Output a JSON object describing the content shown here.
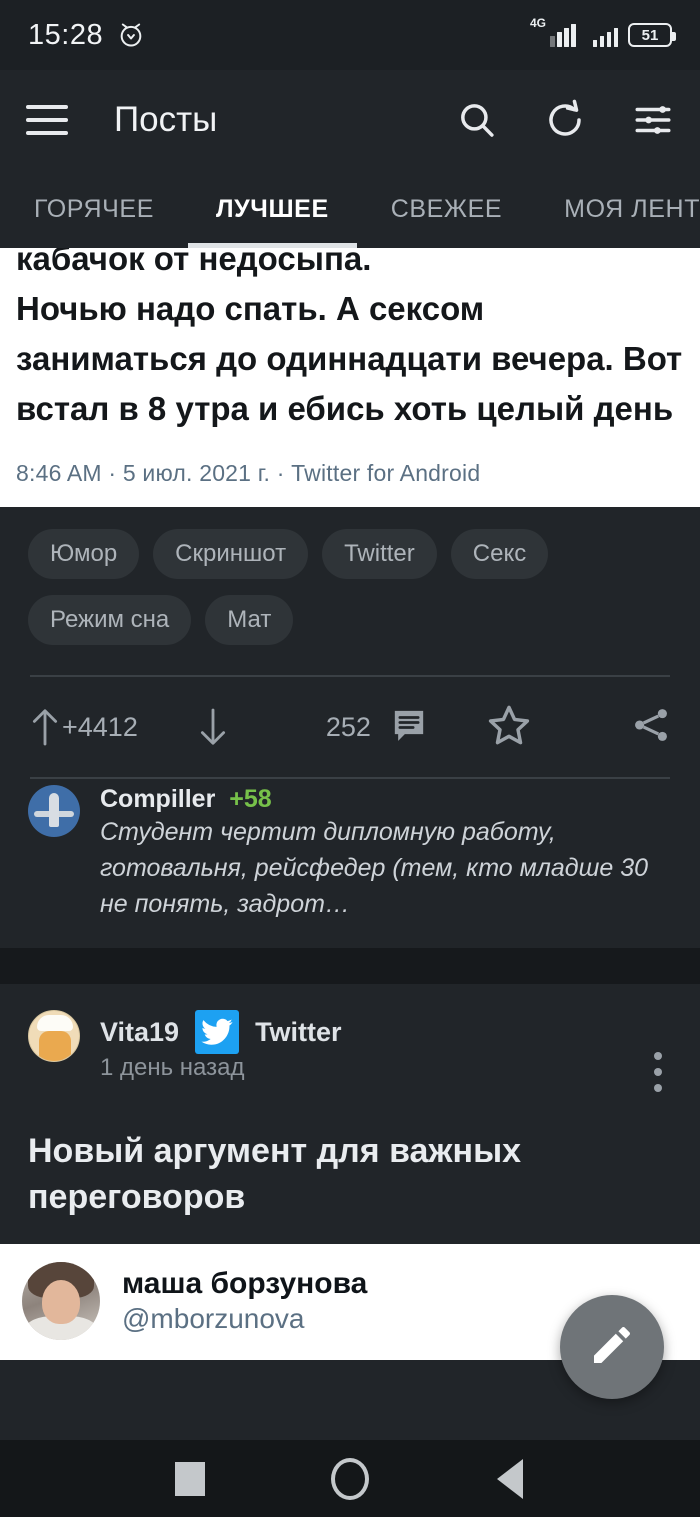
{
  "status_bar": {
    "time": "15:28",
    "alarm_icon": "alarm-clock-icon",
    "network_type": "4G",
    "battery_level": "51"
  },
  "app_bar": {
    "menu_icon": "hamburger-menu-icon",
    "title": "Посты",
    "search_icon": "search-icon",
    "refresh_icon": "refresh-icon",
    "filter_icon": "filter-sliders-icon"
  },
  "tabs": [
    {
      "label": "ГОРЯЧЕЕ",
      "active": false
    },
    {
      "label": "ЛУЧШЕЕ",
      "active": true
    },
    {
      "label": "СВЕЖЕЕ",
      "active": false
    },
    {
      "label": "МОЯ ЛЕНТ",
      "active": false
    }
  ],
  "post_1": {
    "tweet_text_clipped": "кабачок от недосыпа.",
    "tweet_text": "Ночью надо спать. А сексом заниматься до одиннадцати вечера. Вот встал в 8 утра и ебись хоть целый день",
    "tweet_meta": "8:46 AM · 5 июл. 2021 г. · Twitter for Android",
    "tags": [
      "Юмор",
      "Скриншот",
      "Twitter",
      "Секс",
      "Режим сна",
      "Мат"
    ],
    "rating": "+4412",
    "comments_count": "252",
    "upvote_icon": "upvote-arrow-icon",
    "downvote_icon": "downvote-arrow-icon",
    "comments_icon": "comments-icon",
    "favorite_icon": "star-icon",
    "share_icon": "share-icon",
    "comment_preview": {
      "author": "Compiller",
      "score": "+58",
      "text": "Студент чертит дипломную работу, готовальня, рейсфедер (тем, кто младше 30 не понять, задрот…"
    }
  },
  "post_2": {
    "author": "Vita19",
    "community": "Twitter",
    "community_badge_icon": "twitter-bird-icon",
    "time": "1 день назад",
    "more_icon": "kebab-menu-icon",
    "title": "Новый аргумент для важных переговоров",
    "tweet_author_name": "маша борзунова",
    "tweet_author_handle": "@mborzunova"
  },
  "fab": {
    "icon": "pencil-icon"
  },
  "nav_bar": {
    "recents_icon": "square-recents-icon",
    "home_icon": "circle-home-icon",
    "back_icon": "triangle-back-icon"
  }
}
